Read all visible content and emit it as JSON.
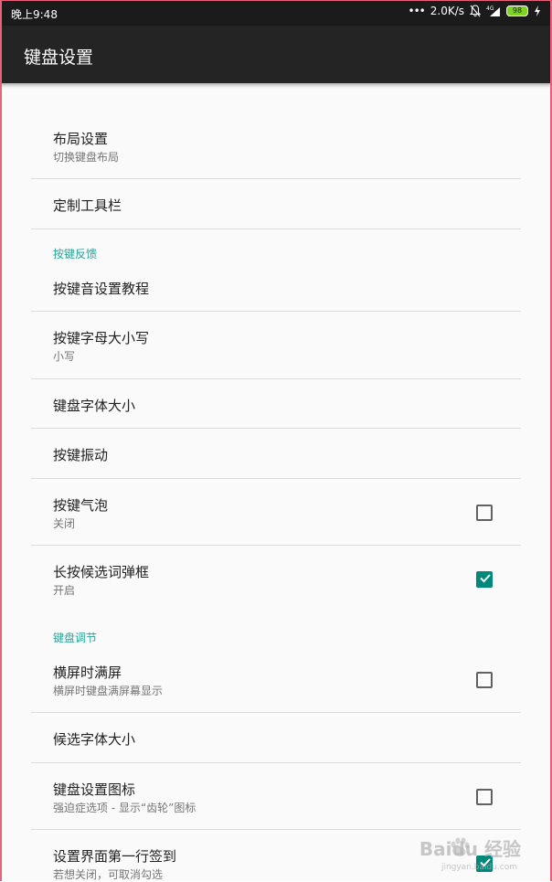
{
  "status_bar": {
    "time": "晚上9:48",
    "dots": "•••",
    "speed": "2.0K/s",
    "network_label": "4G",
    "battery": "98"
  },
  "app_bar": {
    "title": "键盘设置"
  },
  "settings": {
    "layout": {
      "title": "布局设置",
      "summary": "切换键盘布局"
    },
    "toolbar": {
      "title": "定制工具栏"
    },
    "section_feedback": "按键反馈",
    "sound_tutorial": {
      "title": "按键音设置教程"
    },
    "letter_case": {
      "title": "按键字母大小写",
      "summary": "小写"
    },
    "font_size": {
      "title": "键盘字体大小"
    },
    "vibration": {
      "title": "按键振动"
    },
    "bubble": {
      "title": "按键气泡",
      "summary": "关闭",
      "checked": false
    },
    "candidate_popup": {
      "title": "长按候选词弹框",
      "summary": "开启",
      "checked": true
    },
    "section_adjust": "键盘调节",
    "landscape_full": {
      "title": "横屏时满屏",
      "summary": "横屏时键盘满屏幕显示",
      "checked": false
    },
    "candidate_font": {
      "title": "候选字体大小"
    },
    "settings_icon": {
      "title": "键盘设置图标",
      "summary": "强迫症选项 - 显示“齿轮”图标",
      "checked": false
    },
    "first_row_checkin": {
      "title": "设置界面第一行签到",
      "summary": "若想关闭，可取消勾选",
      "checked": true
    }
  },
  "watermark": {
    "brand": "Baidu 经验",
    "url": "jingyan.baidu.com"
  },
  "colors": {
    "accent": "#26a69a",
    "checkbox_checked": "#00897b",
    "appbar": "#242424",
    "statusbar": "#1b1b1b"
  }
}
